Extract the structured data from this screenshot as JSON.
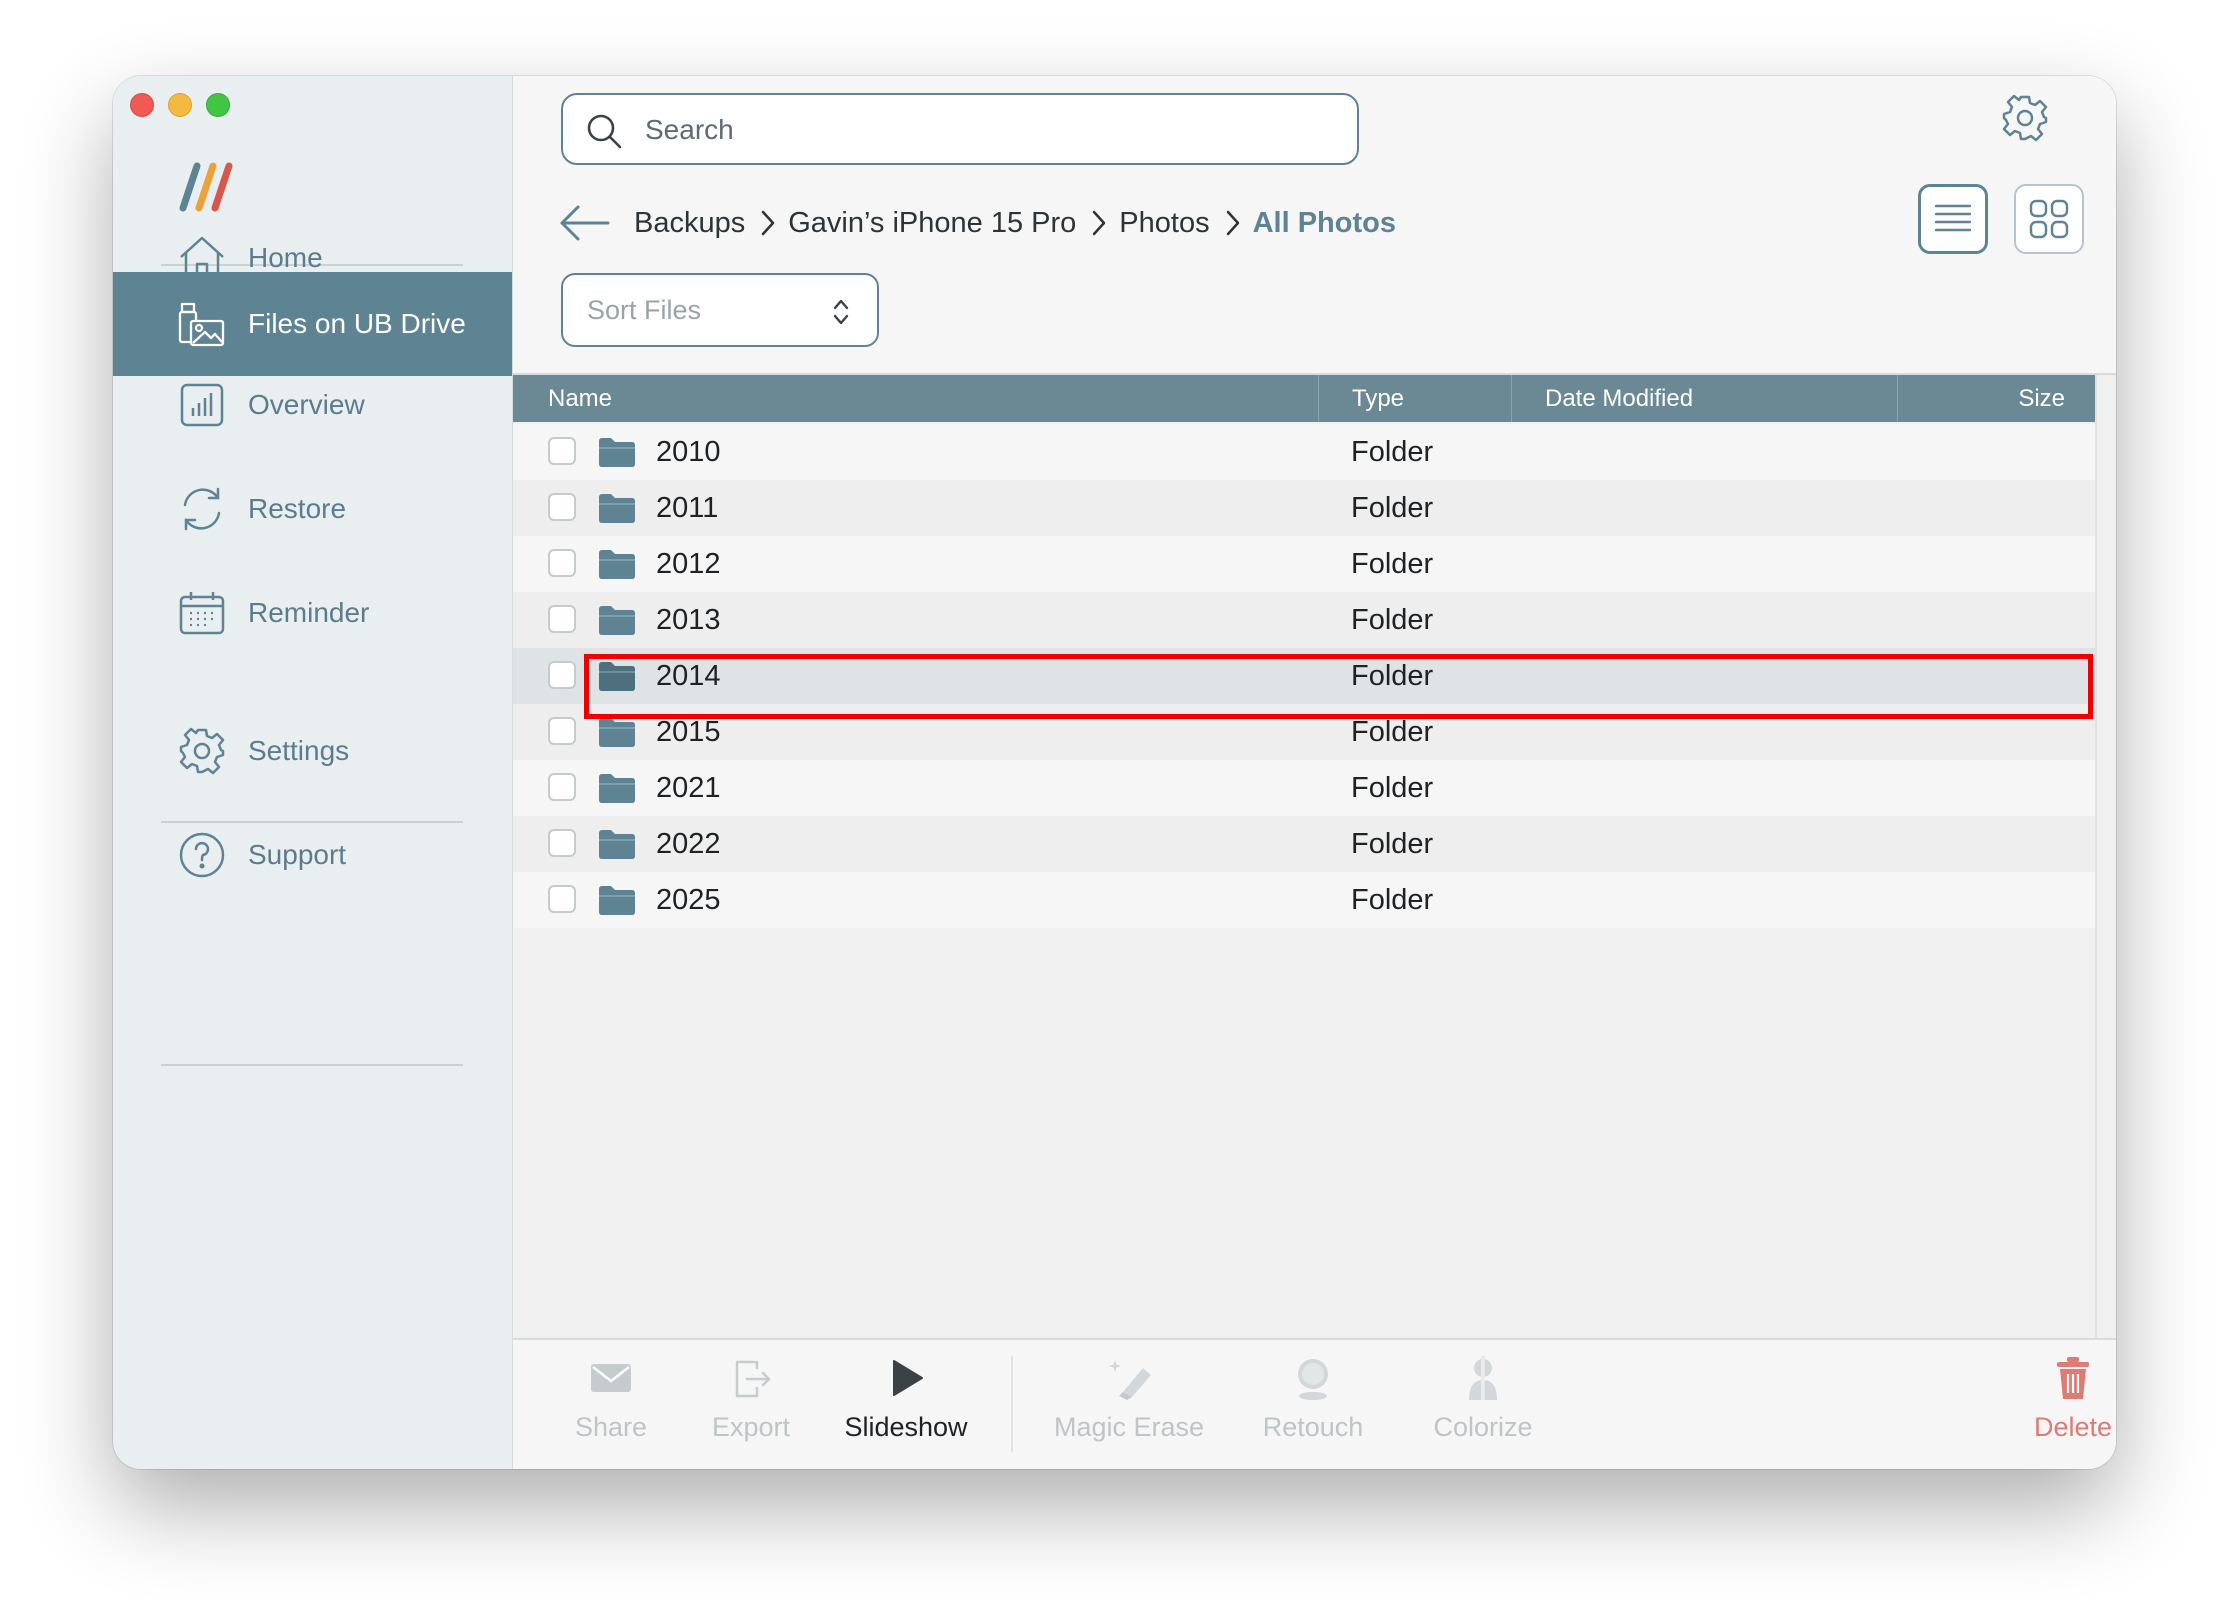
{
  "window": {
    "buttons": [
      "close",
      "minimize",
      "maximize"
    ]
  },
  "sidebar": {
    "logo": "app-logo",
    "items": [
      {
        "label": "Home",
        "icon": "home-icon"
      },
      {
        "label": "Files on UB Drive",
        "icon": "usb-drive-files-icon",
        "active": true
      },
      {
        "label": "Overview",
        "icon": "bar-chart-icon"
      },
      {
        "label": "Restore",
        "icon": "restore-icon"
      },
      {
        "label": "Reminder",
        "icon": "calendar-icon"
      },
      {
        "label": "Settings",
        "icon": "gear-icon"
      },
      {
        "label": "Support",
        "icon": "question-icon"
      }
    ]
  },
  "search": {
    "placeholder": "Search"
  },
  "breadcrumb": {
    "items": [
      "Backups",
      "Gavin’s iPhone 15 Pro",
      "Photos"
    ],
    "current": "All Photos"
  },
  "sort": {
    "label": "Sort Files"
  },
  "table": {
    "columns": [
      "Name",
      "Type",
      "Date Modified",
      "Size"
    ],
    "rows": [
      {
        "name": "2010",
        "type": "Folder"
      },
      {
        "name": "2011",
        "type": "Folder"
      },
      {
        "name": "2012",
        "type": "Folder"
      },
      {
        "name": "2013",
        "type": "Folder"
      },
      {
        "name": "2014",
        "type": "Folder",
        "selected": true
      },
      {
        "name": "2015",
        "type": "Folder"
      },
      {
        "name": "2021",
        "type": "Folder"
      },
      {
        "name": "2022",
        "type": "Folder"
      },
      {
        "name": "2025",
        "type": "Folder"
      }
    ]
  },
  "toolbar": {
    "share": "Share",
    "export": "Export",
    "slideshow": "Slideshow",
    "magic_erase": "Magic Erase",
    "retouch": "Retouch",
    "colorize": "Colorize",
    "delete": "Delete"
  },
  "colors": {
    "accent": "#5e8393",
    "sidebar_bg": "#e9eef0",
    "header_bg": "#6a8995",
    "highlight": "#ee0000",
    "delete": "#e07a74"
  }
}
